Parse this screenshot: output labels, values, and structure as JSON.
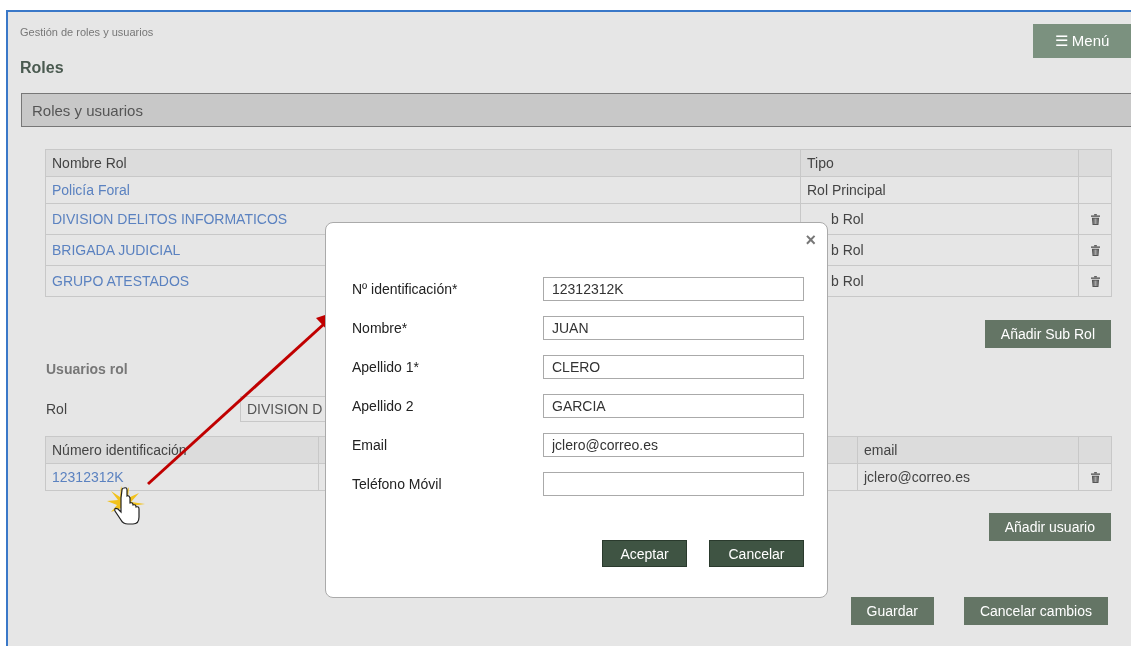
{
  "breadcrumb": "Gestión de roles y usuarios",
  "menu_button": {
    "icon": "☰",
    "label": "Menú"
  },
  "title": "Roles",
  "section_header": "Roles y usuarios",
  "roles_table": {
    "columns": [
      "Nombre Rol",
      "Tipo"
    ],
    "rows": [
      {
        "name": "Policía Foral",
        "type": "Rol Principal",
        "deletable": false
      },
      {
        "name": "DIVISION DELITOS INFORMATICOS",
        "type": "b Rol",
        "deletable": true
      },
      {
        "name": "BRIGADA JUDICIAL",
        "type": "b Rol",
        "deletable": true
      },
      {
        "name": "GRUPO ATESTADOS",
        "type": "b Rol",
        "deletable": true
      }
    ]
  },
  "add_subrole_button": "Añadir Sub Rol",
  "users_section": {
    "title": "Usuarios rol",
    "role_label": "Rol",
    "role_value": "DIVISION D",
    "columns": [
      "Número identificación",
      "email"
    ],
    "rows": [
      {
        "id": "12312312K",
        "email": "jclero@correo.es",
        "deletable": true
      }
    ]
  },
  "add_user_button": "Añadir usuario",
  "footer_buttons": [
    "Guardar",
    "Cancelar cambios"
  ],
  "dialog": {
    "close": "×",
    "fields": [
      {
        "label": "Nº identificación*",
        "value": "12312312K"
      },
      {
        "label": "Nombre*",
        "value": "JUAN"
      },
      {
        "label": "Apellido 1*",
        "value": "CLERO"
      },
      {
        "label": "Apellido 2",
        "value": "GARCIA"
      },
      {
        "label": "Email",
        "value": "jclero@correo.es"
      },
      {
        "label": "Teléfono Móvil"
      }
    ],
    "buttons": [
      "Aceptar",
      "Cancelar"
    ]
  }
}
